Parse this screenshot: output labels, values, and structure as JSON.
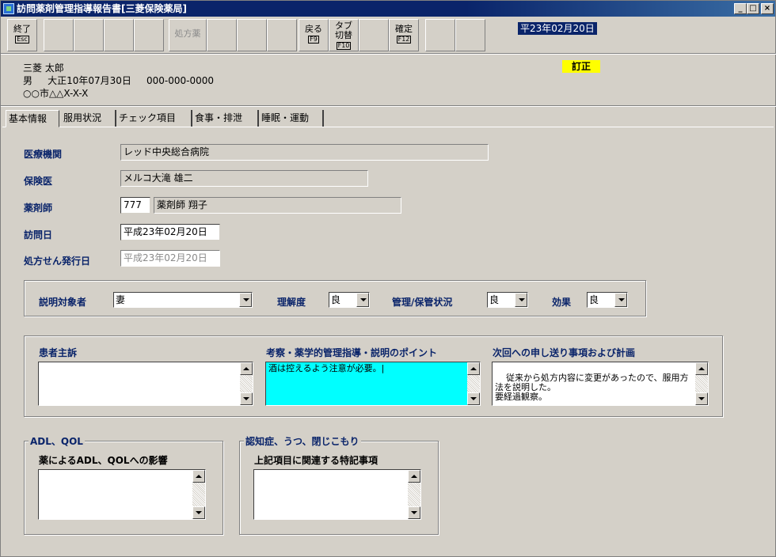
{
  "window": {
    "title": "訪問薬剤管理指導報告書[三菱保険薬局]"
  },
  "toolbar": {
    "exit_label": "終了",
    "exit_key": "Esc",
    "prescription_label": "処方薬",
    "back_label": "戻る",
    "back_key": "F9",
    "tab_switch_label_1": "タブ",
    "tab_switch_label_2": "切替",
    "tab_switch_key": "F10",
    "confirm_label": "確定",
    "confirm_key": "F12"
  },
  "header": {
    "date": "平23年02月20日",
    "correction_badge": "訂正"
  },
  "patient": {
    "name": "三菱 太郎",
    "sex": "男",
    "birthdate": "大正10年07月30日",
    "phone": "000-000-0000",
    "address": "○○市△△X-X-X"
  },
  "tabs": [
    "基本情報",
    "服用状況",
    "チェック項目",
    "食事・排泄",
    "睡眠・運動"
  ],
  "basic": {
    "medical_institution_label": "医療機関",
    "medical_institution_value": "レッド中央総合病院",
    "insurance_doctor_label": "保険医",
    "insurance_doctor_value": "メルコ大滝 雄二",
    "pharmacist_label": "薬剤師",
    "pharmacist_code": "777",
    "pharmacist_name": "薬剤師 翔子",
    "visit_date_label": "訪問日",
    "visit_date_value": "平成23年02月20日",
    "rx_issue_date_label": "処方せん発行日",
    "rx_issue_date_value": "平成23年02月20日"
  },
  "explanation": {
    "target_label": "説明対象者",
    "target_value": "妻",
    "understanding_label": "理解度",
    "understanding_value": "良",
    "management_label": "管理/保管状況",
    "management_value": "良",
    "effect_label": "効果",
    "effect_value": "良"
  },
  "notes": {
    "complaint_label": "患者主訴",
    "complaint_value": "",
    "points_label": "考察・薬学的管理指導・説明のポイント",
    "points_value": "酒は控えるよう注意が必要。|",
    "next_label": "次回への申し送り事項および計画",
    "next_value": "従来から処方内容に変更があったので、服用方法を説明した。\n要経過観察。"
  },
  "adl": {
    "group_title": "ADL、QOL",
    "label": "薬によるADL、QOLへの影響",
    "value": ""
  },
  "dementia": {
    "group_title": "認知症、うつ、閉じこもり",
    "label": "上記項目に関連する特記事項",
    "value": ""
  }
}
